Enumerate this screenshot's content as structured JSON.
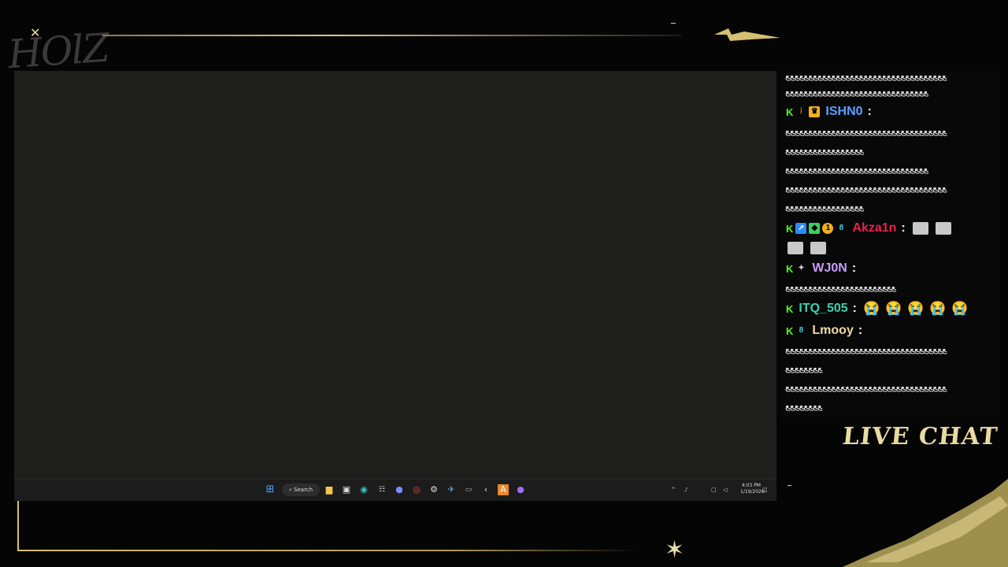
{
  "branding": {
    "logo_text": "HOlZ",
    "live_chat_label": "LIVE CHAT"
  },
  "taskbar": {
    "search_label": "Search",
    "clock_time": "4:03 PM",
    "clock_date": "1/19/2026",
    "apps": [
      "windows-start-icon",
      "file-explorer-icon",
      "microsoft-store-icon",
      "edge-icon",
      "app-icon",
      "discord-icon",
      "chrome-icon",
      "settings-icon",
      "steam-icon",
      "terminal-icon",
      "kick-icon",
      "app-orange-icon",
      "app-purple-icon"
    ]
  },
  "chat": {
    "messages": [
      {
        "text": "ﻊﻊﻊﻊﻊﻊﻊﻊﻊﻊﻊﻊﻊﻊﻊﻊﻊﻊﻊﻊﻊﻊﻊﻊﻊﻊﻊﻊﻊﻊﻊﻊﻊﻊﻊ"
      },
      {
        "text": "ﻊﻊﻊﻊﻊﻊﻊﻊﻊﻊﻊﻊﻊﻊﻊﻊﻊﻊﻊﻊﻊﻊﻊﻊﻊﻊﻊﻊﻊﻊﻊ"
      },
      {
        "username": "ISHN0",
        "color": "#5aa0ff"
      },
      {
        "text": "ﻊﻊﻊﻊﻊﻊﻊﻊﻊﻊﻊﻊﻊﻊﻊﻊﻊﻊﻊﻊﻊﻊﻊﻊﻊﻊﻊﻊﻊﻊﻊﻊﻊﻊﻊ"
      },
      {
        "text": "ﻊﻊﻊﻊﻊﻊﻊﻊﻊﻊﻊﻊﻊﻊﻊﻊﻊ"
      },
      {
        "text": "ﻊﻊﻊﻊﻊﻊﻊﻊﻊﻊﻊﻊﻊﻊﻊﻊﻊﻊﻊﻊﻊﻊﻊﻊﻊﻊﻊﻊﻊﻊﻊ"
      },
      {
        "text": "ﻊﻊﻊﻊﻊﻊﻊﻊﻊﻊﻊﻊﻊﻊﻊﻊﻊﻊﻊﻊﻊﻊﻊﻊﻊﻊﻊﻊﻊﻊﻊﻊﻊﻊﻊ"
      },
      {
        "text": "ﻊﻊﻊﻊﻊﻊﻊﻊﻊﻊﻊﻊﻊﻊﻊﻊﻊ"
      },
      {
        "username": "Akza1n",
        "color": "#e8214d"
      },
      {
        "username": "WJ0N",
        "color": "#c89bff"
      },
      {
        "text": "ﻊﻊﻊﻊﻊﻊﻊﻊﻊﻊﻊﻊﻊﻊﻊﻊﻊﻊﻊﻊﻊﻊﻊﻊ"
      },
      {
        "username": "ITQ_505",
        "color": "#3ad1b0"
      },
      {
        "username": "Lmooy",
        "color": "#f1d8a8"
      },
      {
        "text": "ﻊﻊﻊﻊﻊﻊﻊﻊﻊﻊﻊﻊﻊﻊﻊﻊﻊﻊﻊﻊﻊﻊﻊﻊﻊﻊﻊﻊﻊﻊﻊﻊﻊﻊﻊ"
      },
      {
        "text": "ﻊﻊﻊﻊﻊﻊﻊﻊ"
      },
      {
        "text": "ﻊﻊﻊﻊﻊﻊﻊﻊﻊﻊﻊﻊﻊﻊﻊﻊﻊﻊﻊﻊﻊﻊﻊﻊﻊﻊﻊﻊﻊﻊﻊﻊﻊﻊﻊ"
      },
      {
        "text": "ﻊﻊﻊﻊﻊﻊﻊﻊ"
      }
    ],
    "emoji_crying": "😭",
    "colors": {
      "kick_green": "#53fc18",
      "gold": "#d4c070"
    }
  }
}
